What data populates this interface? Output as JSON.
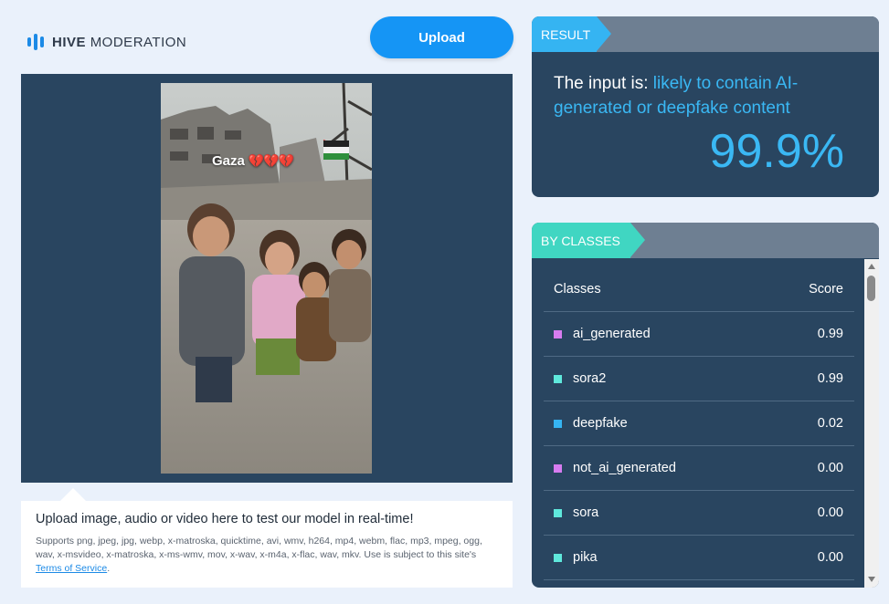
{
  "logo": {
    "brand": "HIVE",
    "product": "MODERATION"
  },
  "upload_button": "Upload",
  "video": {
    "overlay_text": "Gaza",
    "overlay_emoji": "💔💔💔"
  },
  "info": {
    "title": "Upload image, audio or video here to test our model in real-time!",
    "formats": "Supports png, jpeg, jpg, webp, x-matroska, quicktime, avi, wmv, h264, mp4, webm, flac, mp3, mpeg, ogg, wav, x-msvideo, x-matroska, x-ms-wmv, mov, x-wav, x-m4a, x-flac, wav, mkv. Use is subject to this site's",
    "terms_link": "Terms of Service",
    "terms_end": "."
  },
  "result": {
    "tag": "RESULT",
    "prefix": "The input is:",
    "verdict": "likely to contain AI-generated or deepfake content",
    "percentage": "99.9%"
  },
  "by_classes": {
    "tag": "BY CLASSES",
    "header_classes": "Classes",
    "header_score": "Score",
    "rows": [
      {
        "name": "ai_generated",
        "score": "0.99",
        "color": "#d77cf0"
      },
      {
        "name": "sora2",
        "score": "0.99",
        "color": "#5fe8dc"
      },
      {
        "name": "deepfake",
        "score": "0.02",
        "color": "#35b4f2"
      },
      {
        "name": "not_ai_generated",
        "score": "0.00",
        "color": "#d77cf0"
      },
      {
        "name": "sora",
        "score": "0.00",
        "color": "#5fe8dc"
      },
      {
        "name": "pika",
        "score": "0.00",
        "color": "#5fe8dc"
      }
    ]
  },
  "colors": {
    "accent": "#1595f5",
    "panel": "#294560",
    "result_text": "#3ab8f4"
  }
}
